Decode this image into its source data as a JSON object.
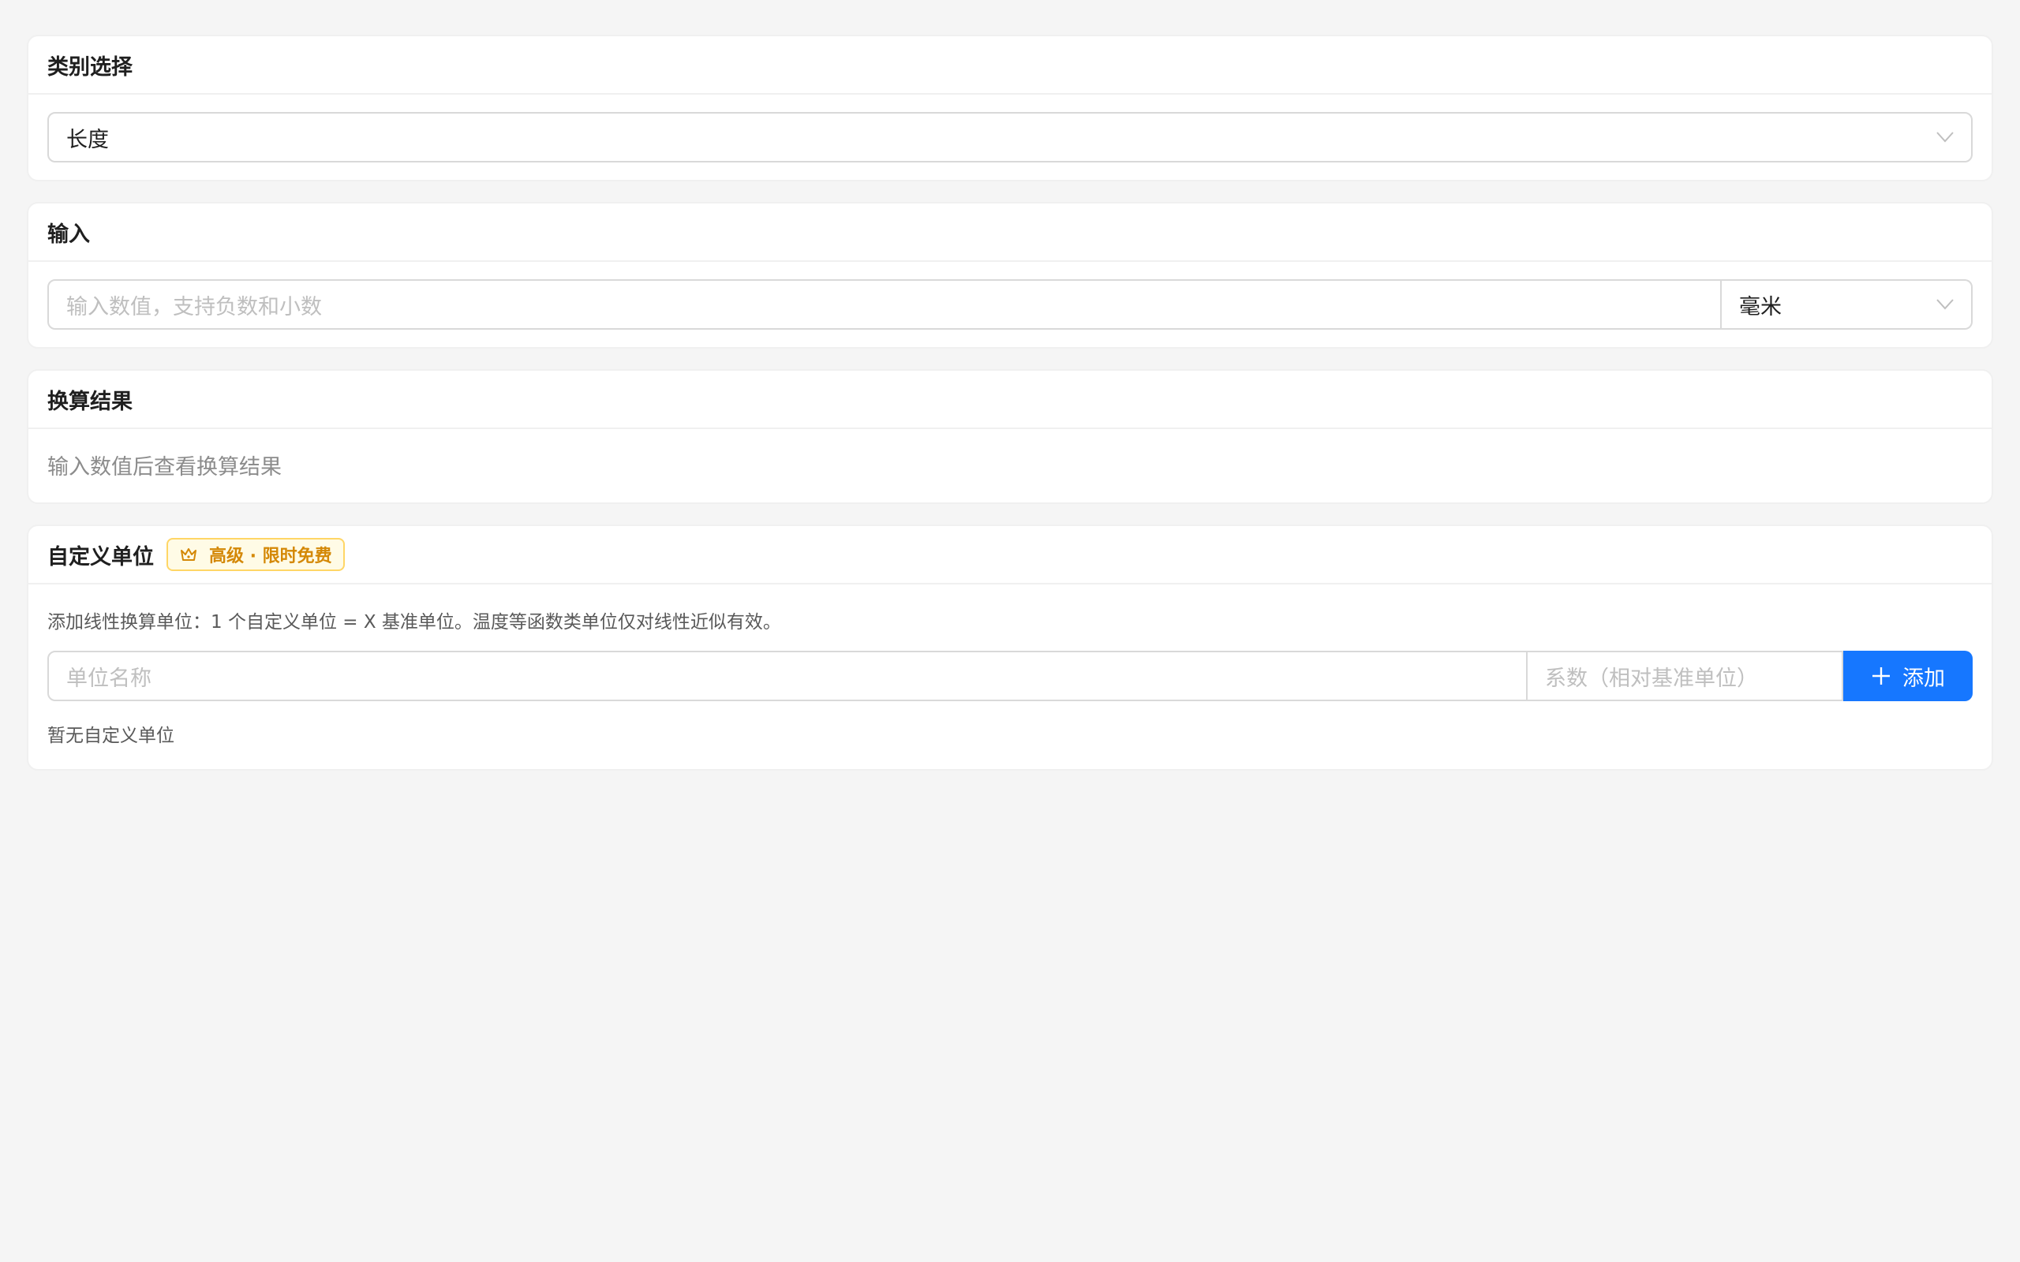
{
  "category": {
    "title": "类别选择",
    "selected": "长度"
  },
  "input": {
    "title": "输入",
    "placeholder": "输入数值，支持负数和小数",
    "unit": "毫米"
  },
  "result": {
    "title": "换算结果",
    "empty_text": "输入数值后查看换算结果"
  },
  "custom": {
    "title": "自定义单位",
    "badge": "高级 · 限时免费",
    "description": "添加线性换算单位：1 个自定义单位 = X 基准单位。温度等函数类单位仅对线性近似有效。",
    "name_placeholder": "单位名称",
    "coef_placeholder": "系数（相对基准单位）",
    "add_label": "添加",
    "empty_text": "暂无自定义单位"
  },
  "colors": {
    "primary": "#1677ff",
    "badge_text": "#d48806",
    "badge_bg": "#fffbe6",
    "badge_border": "#ffd666",
    "background": "#f5f5f5"
  },
  "icons": {
    "select_arrow": "chevron-down-icon",
    "badge": "crown-icon",
    "add": "plus-icon"
  }
}
